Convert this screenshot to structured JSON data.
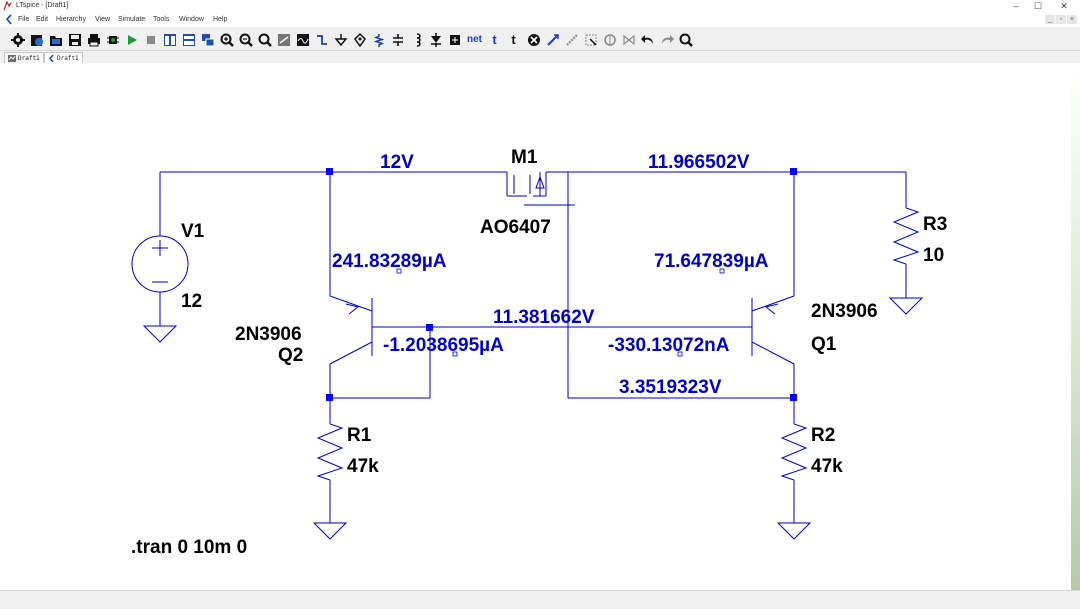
{
  "window": {
    "title": "LTspice - [Draft1]",
    "controls": [
      "–",
      "☐",
      "✕"
    ],
    "mdi_controls": [
      "_",
      "▫",
      "×"
    ]
  },
  "menu": [
    "File",
    "Edit",
    "Hierarchy",
    "View",
    "Simulate",
    "Tools",
    "Window",
    "Help"
  ],
  "toolbar_icons": [
    "settings-icon",
    "open-schematic-icon",
    "open-folder-icon",
    "save-icon",
    "print-icon",
    "component-icon",
    "run-icon",
    "stop-icon",
    "tile-vertical-icon",
    "tile-horizontal-icon",
    "cascade-icon",
    "zoom-in-icon",
    "zoom-out-icon",
    "zoom-fit-icon",
    "autorange-icon",
    "scope-icon",
    "wire-icon",
    "ground-icon",
    "label-net-icon",
    "resistor-icon",
    "capacitor-icon",
    "inductor-icon",
    "diode-icon",
    "component-symbol-icon",
    "net-icon",
    "text-icon",
    "spice-directive-icon",
    "delete-icon",
    "duplicate-icon",
    "move-icon",
    "drag-icon",
    "mirror-icon",
    "undo-icon",
    "redo-icon",
    "find-icon"
  ],
  "toolbar_text": {
    "net": "net",
    "text": "t",
    "directive": "t"
  },
  "tabs": [
    {
      "label": "Draft1"
    },
    {
      "label": "Draft1"
    }
  ],
  "colors": {
    "wire": "#0000c8",
    "label": "#0000c8",
    "symbol_text": "#000000",
    "node": "#0000ff"
  },
  "schematic": {
    "voltages": {
      "top_left": "12V",
      "top_right": "11.966502V",
      "middle": "11.381662V",
      "bottom": "3.3519323V"
    },
    "currents": {
      "q2_emitter": "241.83289µA",
      "q1_emitter": "71.647839µA",
      "q2_base": "-1.2038695µA",
      "q1_base": "-330.13072nA"
    },
    "components": {
      "v1": {
        "name": "V1",
        "value": "12"
      },
      "m1": {
        "name": "M1",
        "value": "AO6407"
      },
      "r3": {
        "name": "R3",
        "value": "10"
      },
      "q2": {
        "name": "Q2",
        "model": "2N3906"
      },
      "q1": {
        "name": "Q1",
        "model": "2N3906"
      },
      "r1": {
        "name": "R1",
        "value": "47k"
      },
      "r2": {
        "name": "R2",
        "value": "47k"
      }
    },
    "directive": ".tran 0 10m 0"
  }
}
